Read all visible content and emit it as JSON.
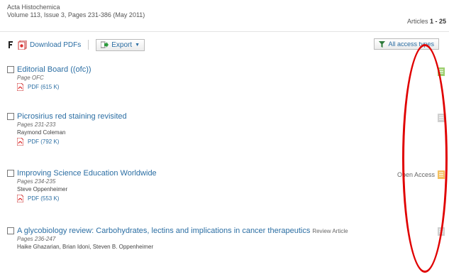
{
  "header": {
    "journal": "Acta Histochemica",
    "volume": "Volume 113, Issue 3, Pages 231-386 (May 2011)",
    "count_prefix": "Articles",
    "count_range": "1 - 25"
  },
  "toolbar": {
    "download_label": "Download PDFs",
    "export_label": "Export",
    "filter_label": "All access types"
  },
  "articles": [
    {
      "title": "Editorial Board ((ofc))",
      "pages": "Page OFC",
      "authors": "",
      "pdf": "PDF (615 K)",
      "access": ""
    },
    {
      "title": "Picrosirius red staining revisited",
      "pages": "Pages 231-233",
      "authors": "Raymond Coleman",
      "pdf": "PDF (792 K)",
      "access": ""
    },
    {
      "title": "Improving Science Education Worldwide",
      "pages": "Pages 234-235",
      "authors": "Steve Oppenheimer",
      "pdf": "PDF (553 K)",
      "access": "Open Access"
    },
    {
      "title": "A glycobiology review: Carbohydrates, lectins and implications in cancer therapeutics",
      "tag": "Review Article",
      "pages": "Pages 236-247",
      "authors": "Haike Ghazarian, Brian Idoni, Steven B. Oppenheimer",
      "pdf": "",
      "access": ""
    }
  ],
  "colors": {
    "link": "#2b6ea3",
    "highlight": "#e00000",
    "open_access_icon": "#f3c060",
    "free_icon": "#9ccf6d",
    "closed_icon": "#cfcfcf"
  }
}
